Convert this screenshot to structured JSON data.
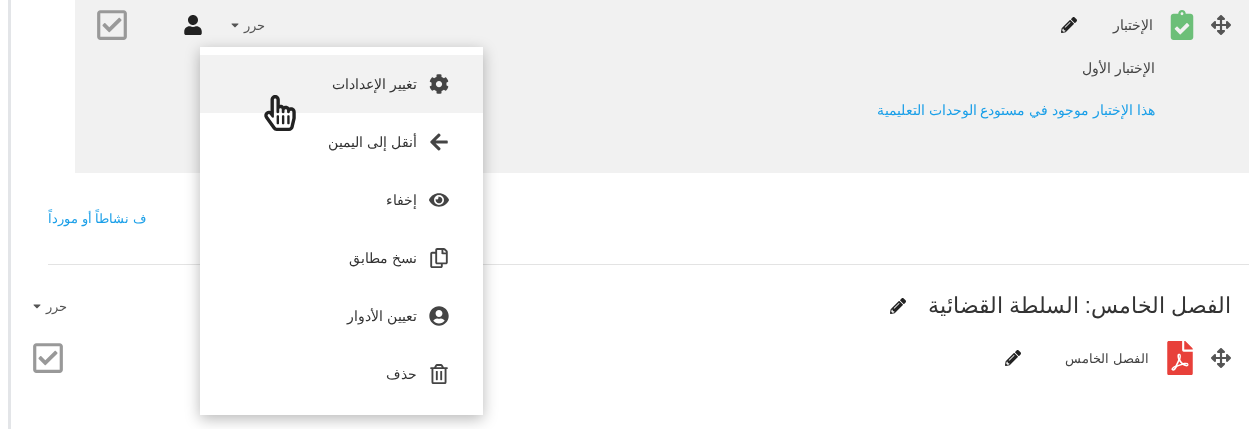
{
  "activity": {
    "kind": "quiz",
    "name": "الإختبار",
    "description": "الإختبار الأول",
    "notice": "هذا الإختبار موجود في مستودع الوحدات التعليمية",
    "completion_checked": true,
    "edit_menu": {
      "label": "حرر",
      "expanded": true,
      "items": [
        {
          "kind": "settings",
          "label": "تغيير الإعدادات",
          "highlighted": true
        },
        {
          "kind": "move",
          "label": "أنقل إلى اليمين",
          "highlighted": false
        },
        {
          "kind": "hide",
          "label": "إخفاء",
          "highlighted": false
        },
        {
          "kind": "duplicate",
          "label": "نسخ مطابق",
          "highlighted": false
        },
        {
          "kind": "roles",
          "label": "تعيين الأدوار",
          "highlighted": false
        },
        {
          "kind": "delete",
          "label": "حذف",
          "highlighted": false
        }
      ]
    }
  },
  "add_activity_link": "ف نشاطاً أو مورداً",
  "section": {
    "title": "الفصل الخامس: السلطة القضائية",
    "edit_label": "حرر",
    "resources": [
      {
        "kind": "pdf",
        "name": "الفصل الخامس",
        "completion_checked": true
      }
    ]
  }
}
